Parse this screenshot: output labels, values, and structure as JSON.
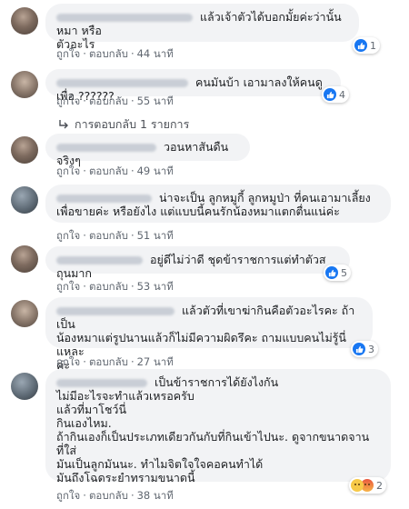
{
  "labels": {
    "like": "ถูกใจ",
    "reply": "ตอบกลับ",
    "separator": "·"
  },
  "replies_link": "การตอบกลับ 1 รายการ",
  "comments": [
    {
      "text": "แล้วเจ้าตัวได้บอกมั้ยค่ะว่านั้นหมา หรือ\nตัวอะไร",
      "time": "44 นาที",
      "reactions": "1"
    },
    {
      "text": "คนมันบ้า เอามาลงให้คนดู เพื่อ ??????",
      "time": "55 นาที",
      "reactions": "4"
    },
    {
      "text": "วอนหาสันดืนจริงๆ",
      "time": "49 นาที",
      "reactions": ""
    },
    {
      "text": "น่าจะเป็น ลูกหมูกี้ ลูกหมูป่า ที่คนเอามาเลี้ยง\nเพื่อขายค่ะ หรือยังไง แต่แบบนี้คนรักน้องหมาแตกตื่นแน่ค่ะ",
      "time": "51 นาที",
      "reactions": ""
    },
    {
      "text": "อยู่ดีไม่ว่าดี ชุดข้าราชการแต่ทำตัวสถุนมาก",
      "time": "53 นาที",
      "reactions": "5"
    },
    {
      "text": "แล้วตัวที่เขาฆ่ากินคือตัวอะไรคะ ถ้าเป็น\nน้องหมาแต่รูปนานแล้วก็ไม่มีความผิดรึคะ ถามแบบคนไม่รู้นี่แหละ\nค่ะ",
      "time": "27 นาที",
      "reactions": "3"
    },
    {
      "text": "เป็นข้าราชการได้ยังไงกัน\nไม่มีอะไรจะทำแล้วเหรอครับ\nแล้วที่มาโชว์นี่\nกินเองไหม.\nถ้ากินเองก็เป็นประเภทเดียวกันกับที่กินเข้าไปนะ. ดูจากขนาดจาน\nที่ใส่\nมันเป็นลูกมันนะ. ทำไมจิตใจใจคอคนทำได้\nมันถึงโฉดระยำทรามขนาดนี้",
      "time": "38 นาที",
      "reactions": "2"
    }
  ]
}
